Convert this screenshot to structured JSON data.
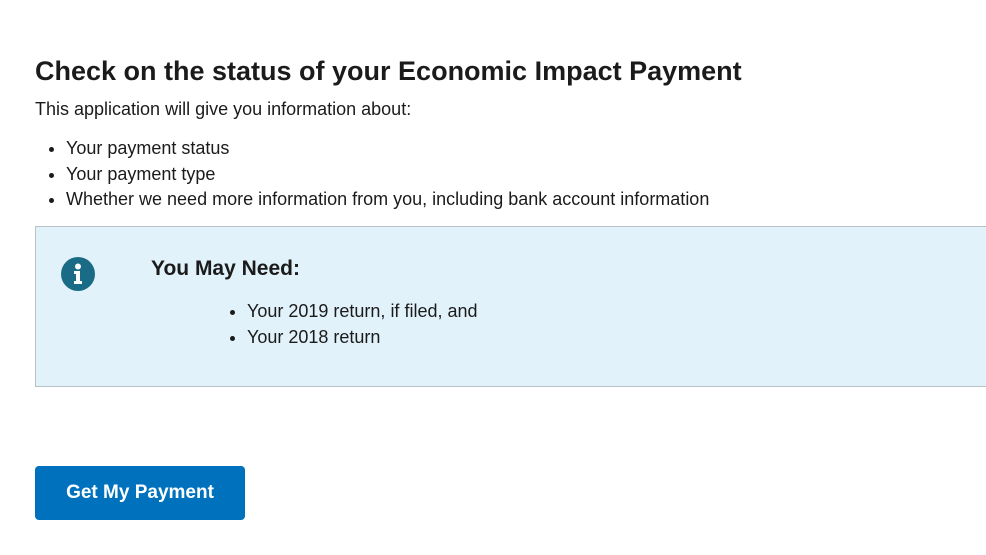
{
  "page": {
    "title": "Check on the status of your Economic Impact Payment",
    "intro": "This application will give you information about:",
    "info_items": [
      "Your payment status",
      "Your payment type",
      "Whether we need more information from you, including bank account information"
    ]
  },
  "alert": {
    "icon": "info-circle-icon",
    "heading": "You May Need:",
    "items": [
      "Your 2019 return, if filed, and",
      "Your 2018 return"
    ]
  },
  "actions": {
    "primary_label": "Get My Payment"
  },
  "colors": {
    "alert_background": "#e1f2fa",
    "alert_border": "#b9c3c7",
    "icon_color": "#1a6b86",
    "button_background": "#0071bc",
    "button_text": "#ffffff"
  }
}
